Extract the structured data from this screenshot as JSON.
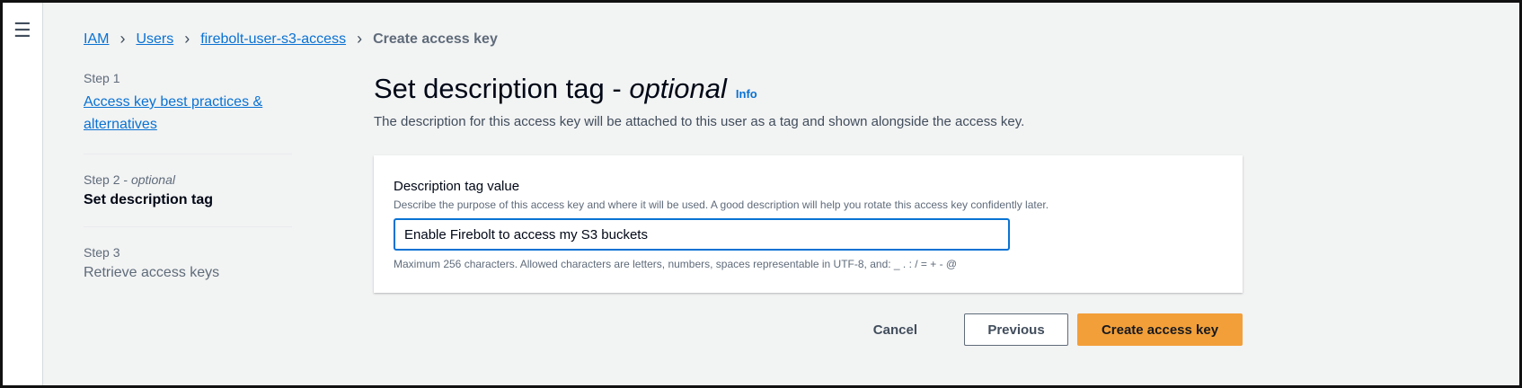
{
  "breadcrumb": [
    "IAM",
    "Users",
    "firebolt-user-s3-access",
    "Create access key"
  ],
  "steps": [
    {
      "num": "Step 1",
      "label": "Access key best practices & alternatives"
    },
    {
      "num": "Step 2",
      "num_suffix": "optional",
      "label": "Set description tag"
    },
    {
      "num": "Step 3",
      "label": "Retrieve access keys"
    }
  ],
  "heading": {
    "title": "Set description tag -",
    "italic": "optional",
    "info": "Info"
  },
  "description": "The description for this access key will be attached to this user as a tag and shown alongside the access key.",
  "field": {
    "label": "Description tag value",
    "hint": "Describe the purpose of this access key and where it will be used. A good description will help you rotate this access key confidently later.",
    "value": "Enable Firebolt to access my S3 buckets",
    "constraint": "Maximum 256 characters. Allowed characters are letters, numbers, spaces representable in UTF-8, and: _ . : / = + - @"
  },
  "buttons": {
    "cancel": "Cancel",
    "previous": "Previous",
    "create": "Create access key"
  },
  "colors": {
    "link": "#0972d3",
    "primary": "#f29f39"
  }
}
